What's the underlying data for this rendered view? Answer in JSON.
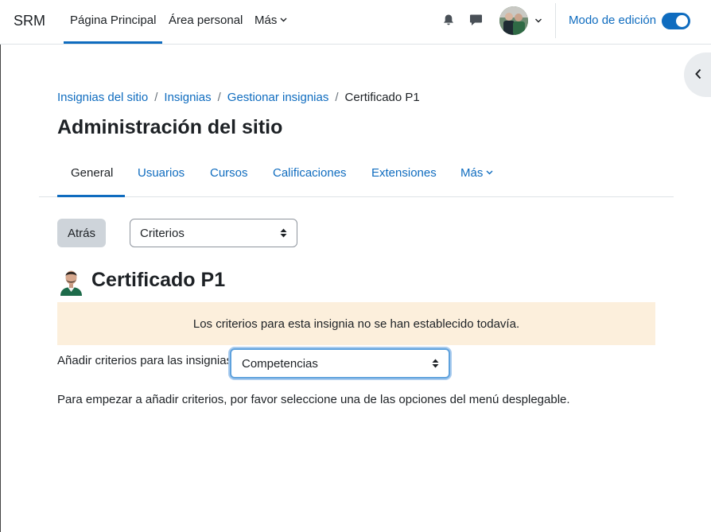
{
  "navbar": {
    "brand": "SRM",
    "items": [
      {
        "label": "Página Principal"
      },
      {
        "label": "Área personal"
      },
      {
        "label": "Más"
      }
    ],
    "edit_mode_label": "Modo de edición"
  },
  "breadcrumb": [
    {
      "label": "Insignias del sitio"
    },
    {
      "label": "Insignias"
    },
    {
      "label": "Gestionar insignias"
    },
    {
      "label": "Certificado P1"
    }
  ],
  "page_title": "Administración del sitio",
  "tabs": [
    {
      "label": "General"
    },
    {
      "label": "Usuarios"
    },
    {
      "label": "Cursos"
    },
    {
      "label": "Calificaciones"
    },
    {
      "label": "Extensiones"
    },
    {
      "label": "Más"
    }
  ],
  "actions": {
    "back_label": "Atrás",
    "criteria_select_value": "Criterios"
  },
  "badge": {
    "title": "Certificado P1"
  },
  "alert_text": "Los criterios para esta insignia no se han establecido todavía.",
  "add_criteria": {
    "label": "Añadir criterios para las insignias",
    "select_value": "Competencias"
  },
  "help_text": "Para empezar a añadir criterios, por favor seleccione una de las opciones del menú desplegable.",
  "colors": {
    "link": "#0f6cbf",
    "alert_bg": "#fcefdc",
    "button_bg": "#ced4da"
  }
}
